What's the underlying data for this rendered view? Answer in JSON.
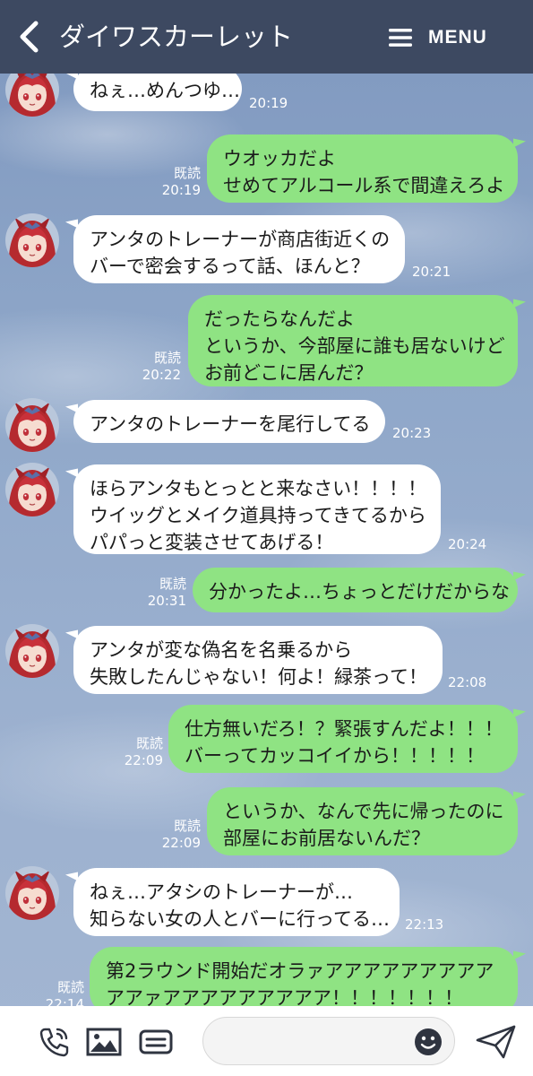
{
  "header": {
    "title": "ダイワスカーレット",
    "menu_label": "MENU"
  },
  "colors": {
    "header_bg": "#3d4961",
    "outgoing_bubble": "#8fe383",
    "incoming_bubble": "#ffffff"
  },
  "messages": [
    {
      "side": "in",
      "text": "ねぇ…めんつゆ…",
      "time": "20:19"
    },
    {
      "side": "out",
      "text": "ウオッカだよ\nせめてアルコール系で間違えろよ",
      "read": "既読",
      "time": "20:19"
    },
    {
      "side": "in",
      "text": "アンタのトレーナーが商店街近くの\nバーで密会するって話、ほんと？",
      "time": "20:21"
    },
    {
      "side": "out",
      "text": "だったらなんだよ\nというか、今部屋に誰も居ないけど\nお前どこに居んだ？",
      "read": "既読",
      "time": "20:22"
    },
    {
      "side": "in",
      "text": "アンタのトレーナーを尾行してる",
      "time": "20:23"
    },
    {
      "side": "in",
      "text": "ほらアンタもとっとと来なさい！！！！\nウイッグとメイク道具持ってきてるから\nパパっと変装させてあげる！",
      "time": "20:24"
    },
    {
      "side": "out",
      "text": "分かったよ…ちょっとだけだからな",
      "read": "既読",
      "time": "20:31"
    },
    {
      "side": "in",
      "text": "アンタが変な偽名を名乗るから\n失敗したんじゃない！何よ！緑茶って！",
      "time": "22:08"
    },
    {
      "side": "out",
      "text": "仕方無いだろ！？緊張すんだよ！！！\nバーってカッコイイから！！！！！",
      "read": "既読",
      "time": "22:09"
    },
    {
      "side": "out",
      "text": "というか、なんで先に帰ったのに\n部屋にお前居ないんだ？",
      "read": "既読",
      "time": "22:09"
    },
    {
      "side": "in",
      "text": "ねぇ…アタシのトレーナーが…\n知らない女の人とバーに行ってる…",
      "time": "22:13"
    },
    {
      "side": "out",
      "text": "第2ラウンド開始だオラァアアアアアアアアア\nアアァアアアアアアアアア！！！！！！！",
      "read": "既読",
      "time": "22:14"
    }
  ],
  "composer": {
    "placeholder": ""
  },
  "icons": [
    "back-chevron-icon",
    "menu-hamburger-icon",
    "phone-icon",
    "image-icon",
    "keyboard-icon",
    "emoji-icon",
    "send-icon"
  ]
}
